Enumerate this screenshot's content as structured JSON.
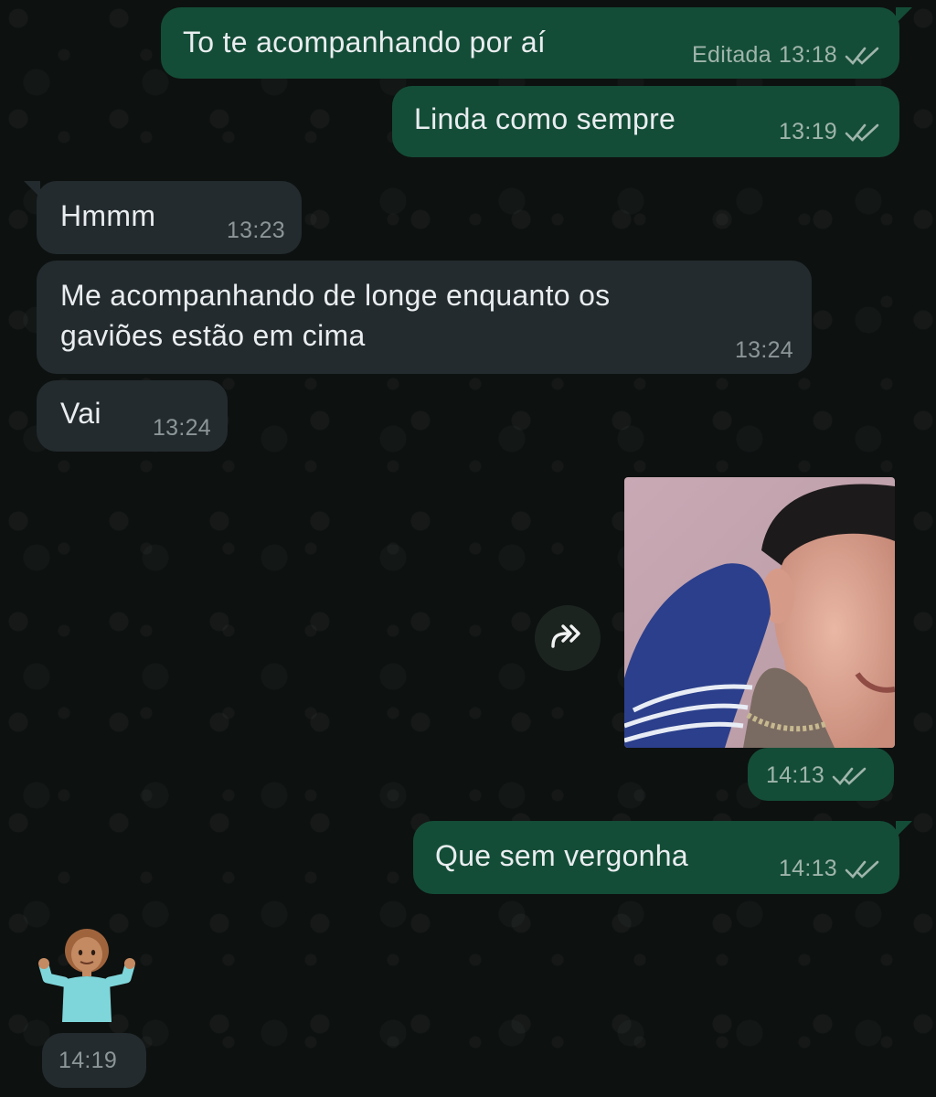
{
  "messages": [
    {
      "direction": "outgoing",
      "text": "To te acompanhando por aí",
      "edited_label": "Editada",
      "time": "13:18",
      "status": "read"
    },
    {
      "direction": "outgoing",
      "text": "Linda como sempre",
      "time": "13:19",
      "status": "read"
    },
    {
      "direction": "incoming",
      "text": "Hmmm",
      "time": "13:23"
    },
    {
      "direction": "incoming",
      "text_line1": "Me acompanhando de longe enquanto os",
      "text_line2": "gaviões estão em cima",
      "time": "13:24"
    },
    {
      "direction": "incoming",
      "text": "Vai",
      "time": "13:24"
    },
    {
      "direction": "outgoing",
      "type": "image",
      "time": "14:13",
      "status": "read"
    },
    {
      "direction": "outgoing",
      "text": "Que sem vergonha",
      "time": "14:13",
      "status": "read"
    },
    {
      "direction": "incoming",
      "type": "emoji",
      "emoji": "🤷🏽‍♀️",
      "time": "14:19"
    }
  ],
  "icons": {
    "read_receipt": "double-check-icon",
    "forward": "forward-icon"
  },
  "colors": {
    "outgoing_bubble": "#144d37",
    "incoming_bubble": "#232b2e",
    "background": "#0d1110",
    "text": "#e9edef"
  }
}
